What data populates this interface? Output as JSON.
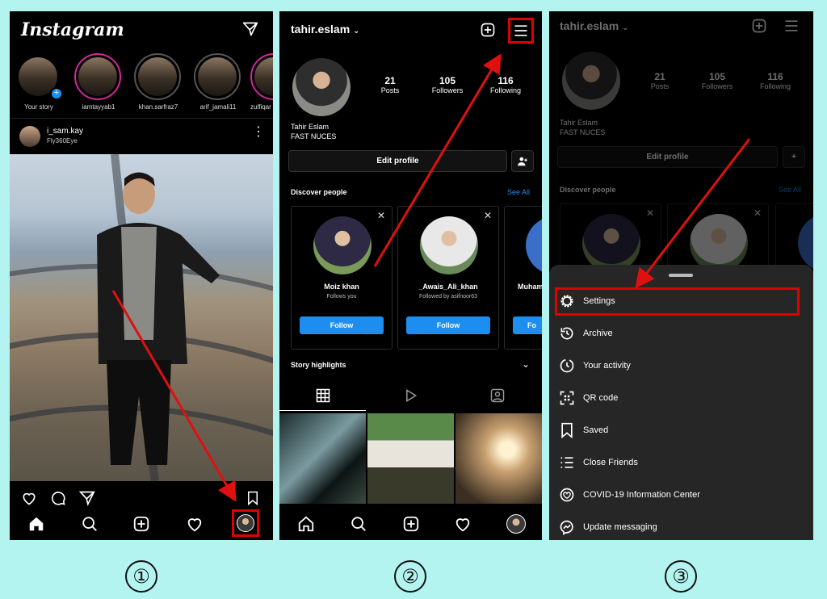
{
  "steps": [
    "①",
    "②",
    "③"
  ],
  "feed": {
    "app_name": "Instagram",
    "stories": [
      {
        "label": "Your story"
      },
      {
        "label": "iamtayyab1"
      },
      {
        "label": "khan.sarfraz7"
      },
      {
        "label": "arif_jamali11"
      },
      {
        "label": "zulfiqar"
      }
    ],
    "post": {
      "username": "i_sam.kay",
      "subtitle": "Fly360Eye"
    }
  },
  "profile": {
    "username": "tahir.eslam",
    "stats": [
      {
        "value": "21",
        "label": "Posts"
      },
      {
        "value": "105",
        "label": "Followers"
      },
      {
        "value": "116",
        "label": "Following"
      }
    ],
    "name": "Tahir Eslam",
    "bio": "FAST NUCES",
    "edit_label": "Edit profile",
    "discover_label": "Discover people",
    "see_all_label": "See All",
    "suggestions": [
      {
        "name": "Moiz khan",
        "sub": "Follows you",
        "button": "Follow"
      },
      {
        "name": "_Awais_Ali_khan",
        "sub": "Followed by asifnoor63",
        "button": "Follow"
      },
      {
        "name": "Muham",
        "sub": "",
        "button": "Fo"
      }
    ],
    "highlights_label": "Story highlights"
  },
  "menu": {
    "items": [
      {
        "label": "Settings",
        "icon": "settings-icon"
      },
      {
        "label": "Archive",
        "icon": "archive-icon"
      },
      {
        "label": "Your activity",
        "icon": "activity-icon"
      },
      {
        "label": "QR code",
        "icon": "qr-code-icon"
      },
      {
        "label": "Saved",
        "icon": "bookmark-icon"
      },
      {
        "label": "Close Friends",
        "icon": "close-friends-icon"
      },
      {
        "label": "COVID-19 Information Center",
        "icon": "covid-info-icon"
      },
      {
        "label": "Update messaging",
        "icon": "messenger-icon"
      }
    ]
  },
  "colors": {
    "highlight": "#e00000",
    "arrow": "#e01010",
    "follow": "#1d8ef0",
    "background": "#b3f3f0"
  }
}
